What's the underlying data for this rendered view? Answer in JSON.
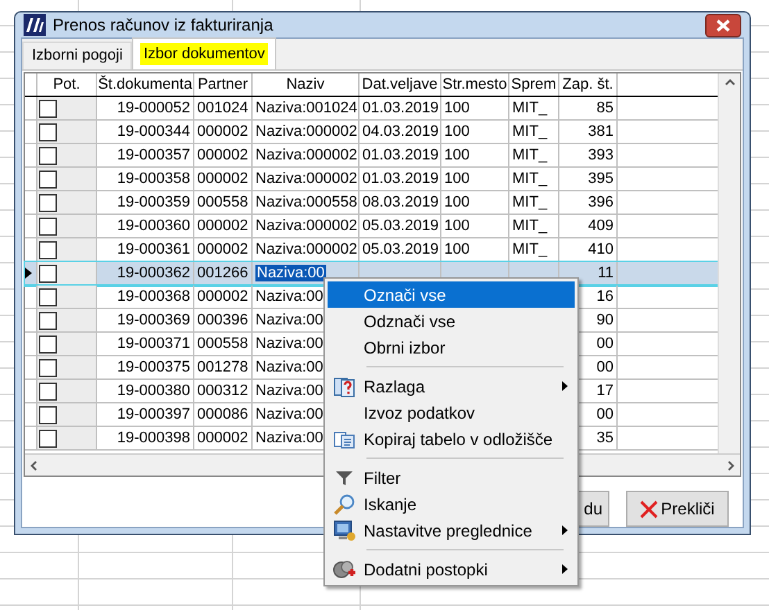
{
  "window": {
    "title": "Prenos računov iz fakturiranja"
  },
  "tabs": [
    {
      "label": "Izborni pogoji",
      "selected": false
    },
    {
      "label": "Izbor dokumentov",
      "selected": true
    }
  ],
  "table": {
    "columns": [
      "Pot.",
      "Št.dokumenta",
      "Partner",
      "Naziv",
      "Dat.veljave",
      "Str.mesto",
      "Sprem",
      "Zap. št."
    ],
    "rows": [
      {
        "checked": false,
        "selected": false,
        "document": "19-000052",
        "partner": "001024",
        "name": "Naziva:001024",
        "date": "01.03.2019",
        "cost_center": "100",
        "changed_by": "MIT_",
        "entry_no": "85"
      },
      {
        "checked": false,
        "selected": false,
        "document": "19-000344",
        "partner": "000002",
        "name": "Naziva:000002",
        "date": "04.03.2019",
        "cost_center": "100",
        "changed_by": "MIT_",
        "entry_no": "381"
      },
      {
        "checked": false,
        "selected": false,
        "document": "19-000357",
        "partner": "000002",
        "name": "Naziva:000002",
        "date": "01.03.2019",
        "cost_center": "100",
        "changed_by": "MIT_",
        "entry_no": "393"
      },
      {
        "checked": false,
        "selected": false,
        "document": "19-000358",
        "partner": "000002",
        "name": "Naziva:000002",
        "date": "01.03.2019",
        "cost_center": "100",
        "changed_by": "MIT_",
        "entry_no": "395"
      },
      {
        "checked": false,
        "selected": false,
        "document": "19-000359",
        "partner": "000558",
        "name": "Naziva:000558",
        "date": "08.03.2019",
        "cost_center": "100",
        "changed_by": "MIT_",
        "entry_no": "396"
      },
      {
        "checked": false,
        "selected": false,
        "document": "19-000360",
        "partner": "000002",
        "name": "Naziva:000002",
        "date": "05.03.2019",
        "cost_center": "100",
        "changed_by": "MIT_",
        "entry_no": "409"
      },
      {
        "checked": false,
        "selected": false,
        "document": "19-000361",
        "partner": "000002",
        "name": "Naziva:000002",
        "date": "05.03.2019",
        "cost_center": "100",
        "changed_by": "MIT_",
        "entry_no": "410"
      },
      {
        "checked": false,
        "selected": true,
        "document": "19-000362",
        "partner": "001266",
        "name": "Naziva:00",
        "entry_no": "11"
      },
      {
        "checked": false,
        "selected": false,
        "document": "19-000368",
        "partner": "000002",
        "name": "Naziva:00",
        "entry_no": "16"
      },
      {
        "checked": false,
        "selected": false,
        "document": "19-000369",
        "partner": "000396",
        "name": "Naziva:00",
        "entry_no": "90"
      },
      {
        "checked": false,
        "selected": false,
        "document": "19-000371",
        "partner": "000558",
        "name": "Naziva:00",
        "entry_no": "00"
      },
      {
        "checked": false,
        "selected": false,
        "document": "19-000375",
        "partner": "001278",
        "name": "Naziva:00",
        "entry_no": "00"
      },
      {
        "checked": false,
        "selected": false,
        "document": "19-000380",
        "partner": "000312",
        "name": "Naziva:00",
        "entry_no": "17"
      },
      {
        "checked": false,
        "selected": false,
        "document": "19-000397",
        "partner": "000086",
        "name": "Naziva:00",
        "entry_no": "00"
      },
      {
        "checked": false,
        "selected": false,
        "document": "19-000398",
        "partner": "000002",
        "name": "Naziva:00",
        "entry_no": "35"
      }
    ]
  },
  "buttons": [
    {
      "kind": "partial",
      "label": "du"
    },
    {
      "kind": "cancel",
      "label": "Prekliči"
    }
  ],
  "context_menu": [
    {
      "kind": "item",
      "label": "Označi vse",
      "submenu": false,
      "selected": true
    },
    {
      "kind": "item",
      "label": "Odznači vse",
      "submenu": false,
      "selected": false
    },
    {
      "kind": "item",
      "label": "Obrni izbor",
      "submenu": false,
      "selected": false
    },
    {
      "kind": "separator"
    },
    {
      "kind": "item",
      "label": "Razlaga",
      "submenu": true,
      "selected": false
    },
    {
      "kind": "item",
      "label": "Izvoz podatkov",
      "submenu": false,
      "selected": false
    },
    {
      "kind": "item",
      "label": "Kopiraj tabelo v odložišče",
      "submenu": false,
      "selected": false
    },
    {
      "kind": "separator"
    },
    {
      "kind": "item",
      "label": "Filter",
      "submenu": false,
      "selected": false
    },
    {
      "kind": "item",
      "label": "Iskanje",
      "submenu": false,
      "selected": false
    },
    {
      "kind": "item",
      "label": "Nastavitve preglednice",
      "submenu": true,
      "selected": false
    },
    {
      "kind": "separator"
    },
    {
      "kind": "item",
      "label": "Dodatni postopki",
      "submenu": true,
      "selected": false
    }
  ]
}
